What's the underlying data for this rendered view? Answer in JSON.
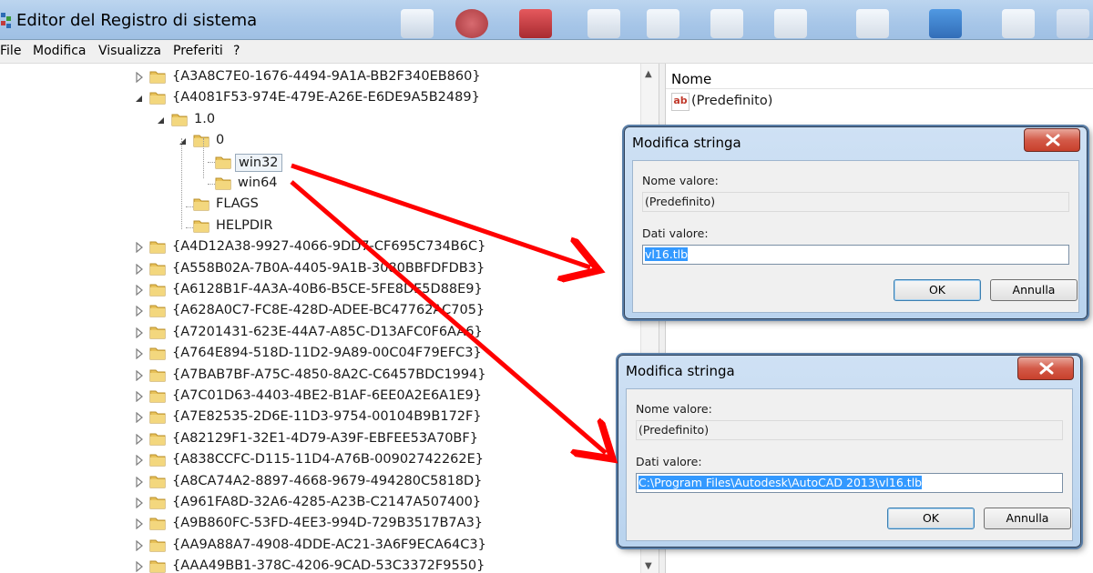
{
  "window": {
    "title": "Editor del Registro di sistema"
  },
  "menu": {
    "items": [
      "File",
      "Modifica",
      "Visualizza",
      "Preferiti",
      "?"
    ]
  },
  "tree": {
    "rows": [
      {
        "label": "{A3A8C7E0-1676-4494-9A1A-BB2F340EB860}",
        "state": "collapsed"
      },
      {
        "label": "{A4081F53-974E-479E-A26E-E6DE9A5B2489}",
        "state": "expanded"
      },
      {
        "label": "1.0",
        "state": "expanded"
      },
      {
        "label": "0",
        "state": "expanded"
      },
      {
        "label": "win32",
        "state": "leaf"
      },
      {
        "label": "win64",
        "state": "leaf"
      },
      {
        "label": "FLAGS",
        "state": "leaf"
      },
      {
        "label": "HELPDIR",
        "state": "leaf"
      },
      {
        "label": "{A4D12A38-9927-4066-9DD7-CF695C734B6C}",
        "state": "collapsed"
      },
      {
        "label": "{A558B02A-7B0A-4405-9A1B-3080BBFDFDB3}",
        "state": "collapsed"
      },
      {
        "label": "{A6128B1F-4A3A-40B6-B5CE-5FE8DE5D88E9}",
        "state": "collapsed"
      },
      {
        "label": "{A628A0C7-FC8E-428D-ADEE-BC47762AC705}",
        "state": "collapsed"
      },
      {
        "label": "{A7201431-623E-44A7-A85C-D13AFC0F6AA6}",
        "state": "collapsed"
      },
      {
        "label": "{A764E894-518D-11D2-9A89-00C04F79EFC3}",
        "state": "collapsed"
      },
      {
        "label": "{A7BAB7BF-A75C-4850-8A2C-C6457BDC1994}",
        "state": "collapsed"
      },
      {
        "label": "{A7C01D63-4403-4BE2-B1AF-6EE0A2E6A1E9}",
        "state": "collapsed"
      },
      {
        "label": "{A7E82535-2D6E-11D3-9754-00104B9B172F}",
        "state": "collapsed"
      },
      {
        "label": "{A82129F1-32E1-4D79-A39F-EBFEE53A70BF}",
        "state": "collapsed"
      },
      {
        "label": "{A838CCFC-D115-11D4-A76B-00902742262E}",
        "state": "collapsed"
      },
      {
        "label": "{A8CA74A2-8897-4668-9679-494280C5818D}",
        "state": "collapsed"
      },
      {
        "label": "{A961FA8D-32A6-4285-A23B-C2147A507400}",
        "state": "collapsed"
      },
      {
        "label": "{A9B860FC-53FD-4EE3-994D-729B3517B7A3}",
        "state": "collapsed"
      },
      {
        "label": "{AA9A88A7-4908-4DDE-AC21-3A6F9ECA64C3}",
        "state": "collapsed"
      },
      {
        "label": "{AAA49BB1-378C-4206-9CAD-53C3372F9550}",
        "state": "collapsed"
      }
    ]
  },
  "list": {
    "column_name": "Nome",
    "values": [
      {
        "name": "(Predefinito)"
      }
    ]
  },
  "dialog1": {
    "title": "Modifica stringa",
    "name_label": "Nome valore:",
    "name_value": "(Predefinito)",
    "data_label": "Dati valore:",
    "data_value": "vl16.tlb",
    "ok": "OK",
    "cancel": "Annulla"
  },
  "dialog2": {
    "title": "Modifica stringa",
    "name_label": "Nome valore:",
    "name_value": "(Predefinito)",
    "data_label": "Dati valore:",
    "data_value": "C:\\Program Files\\Autodesk\\AutoCAD 2013\\vl16.tlb",
    "ok": "OK",
    "cancel": "Annulla"
  },
  "colors": {
    "arrow": "#ff0000",
    "folder": "#e8c25a",
    "selection": "#3399ff",
    "close_button": "#c8402c"
  }
}
